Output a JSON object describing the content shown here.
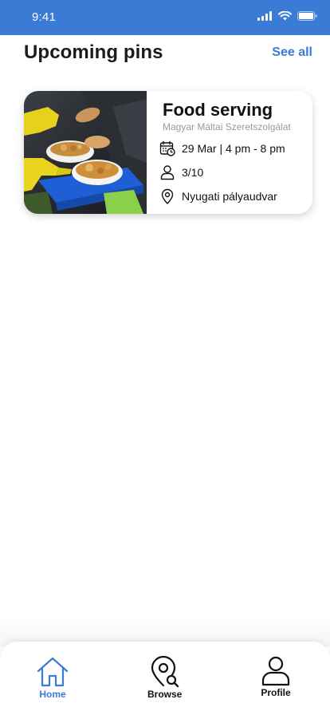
{
  "status_bar": {
    "time": "9:41"
  },
  "section": {
    "title": "Upcoming pins",
    "see_all": "See all"
  },
  "card": {
    "title": "Food serving",
    "organization": "Magyar Máltai Szeretszolgálat",
    "date_time": "29 Mar | 4 pm - 8 pm",
    "participants": "3/10",
    "location": "Nyugati pályaudvar",
    "photo_icon": "food-serving-photo"
  },
  "tabs": [
    {
      "label": "Home",
      "icon": "home-icon",
      "active": true
    },
    {
      "label": "Browse",
      "icon": "map-search-icon",
      "active": false
    },
    {
      "label": "Profile",
      "icon": "user-icon",
      "active": false
    }
  ],
  "colors": {
    "accent": "#3a7bd5",
    "status_bar": "#3a7bd5",
    "text": "#111111",
    "muted": "#9a9a9a"
  }
}
